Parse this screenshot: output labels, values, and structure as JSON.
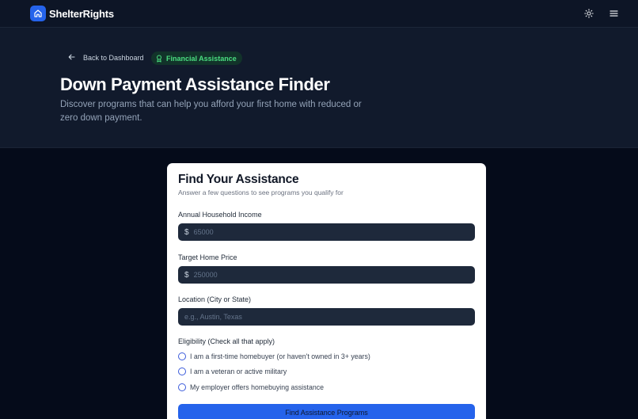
{
  "brand": {
    "name": "ShelterRights",
    "logo_icon": "home-icon"
  },
  "header": {
    "theme_icon": "sun-icon",
    "menu_icon": "menu-icon"
  },
  "hero": {
    "back_label": "Back to Dashboard",
    "chip_label": "Financial Assistance",
    "title": "Down Payment Assistance Finder",
    "subtitle": "Discover programs that can help you afford your first home with reduced or zero down payment."
  },
  "form": {
    "title": "Find Your Assistance",
    "subtitle": "Answer a few questions to see programs you qualify for",
    "income": {
      "label": "Annual Household Income",
      "prefix": "$",
      "placeholder": "65000"
    },
    "price": {
      "label": "Target Home Price",
      "prefix": "$",
      "placeholder": "250000"
    },
    "location": {
      "label": "Location (City or State)",
      "placeholder": "e.g., Austin, Texas"
    },
    "eligibility": {
      "label": "Eligibility (Check all that apply)",
      "options": [
        "I am a first-time homebuyer (or haven't owned in 3+ years)",
        "I am a veteran or active military",
        "My employer offers homebuying assistance"
      ]
    },
    "submit_label": "Find Assistance Programs"
  },
  "colors": {
    "accent": "#2563eb",
    "chip_text": "#4ade80",
    "page_bg": "#050b1a"
  }
}
